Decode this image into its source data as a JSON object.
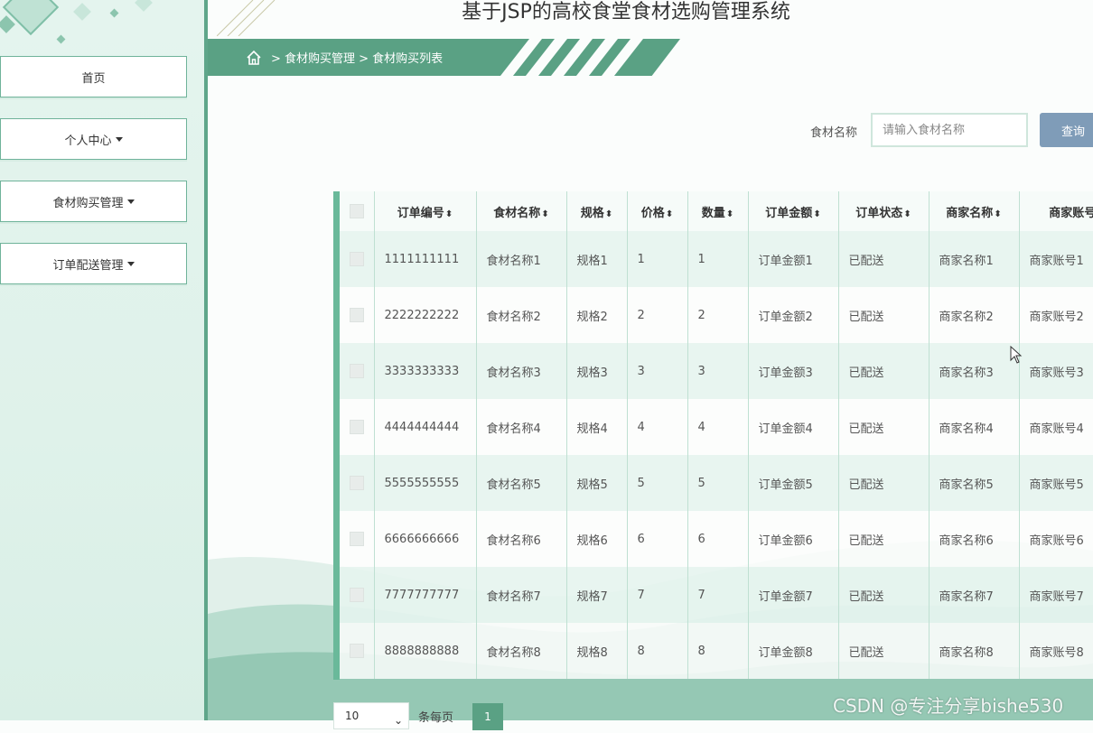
{
  "app_title": "基于JSP的高校食堂食材选购管理系统",
  "sidebar": {
    "items": [
      {
        "label": "首页",
        "has_caret": false
      },
      {
        "label": "个人中心",
        "has_caret": true
      },
      {
        "label": "食材购买管理",
        "has_caret": true
      },
      {
        "label": "订单配送管理",
        "has_caret": true
      }
    ]
  },
  "breadcrumb": {
    "home_icon": "home-icon",
    "text": "> 食材购买管理 > 食材购买列表"
  },
  "search": {
    "label": "食材名称",
    "placeholder": "请输入食材名称",
    "button_label": "查询"
  },
  "table": {
    "headers": [
      "订单编号",
      "食材名称",
      "规格",
      "价格",
      "数量",
      "订单金额",
      "订单状态",
      "商家名称",
      "商家账号"
    ],
    "sort_icon": "sort-icon",
    "rows": [
      [
        "1111111111",
        "食材名称1",
        "规格1",
        "1",
        "1",
        "订单金额1",
        "已配送",
        "商家名称1",
        "商家账号1"
      ],
      [
        "2222222222",
        "食材名称2",
        "规格2",
        "2",
        "2",
        "订单金额2",
        "已配送",
        "商家名称2",
        "商家账号2"
      ],
      [
        "3333333333",
        "食材名称3",
        "规格3",
        "3",
        "3",
        "订单金额3",
        "已配送",
        "商家名称3",
        "商家账号3"
      ],
      [
        "4444444444",
        "食材名称4",
        "规格4",
        "4",
        "4",
        "订单金额4",
        "已配送",
        "商家名称4",
        "商家账号4"
      ],
      [
        "5555555555",
        "食材名称5",
        "规格5",
        "5",
        "5",
        "订单金额5",
        "已配送",
        "商家名称5",
        "商家账号5"
      ],
      [
        "6666666666",
        "食材名称6",
        "规格6",
        "6",
        "6",
        "订单金额6",
        "已配送",
        "商家名称6",
        "商家账号6"
      ],
      [
        "7777777777",
        "食材名称7",
        "规格7",
        "7",
        "7",
        "订单金额7",
        "已配送",
        "商家名称7",
        "商家账号7"
      ],
      [
        "8888888888",
        "食材名称8",
        "规格8",
        "8",
        "8",
        "订单金额8",
        "已配送",
        "商家名称8",
        "商家账号8"
      ]
    ]
  },
  "pagination": {
    "page_size": "10",
    "per_page_label": "条每页",
    "current_page": "1"
  },
  "watermark": "CSDN @专注分享bishe530",
  "colors": {
    "accent": "#5aa184",
    "sidebar_bg": "#e4f4ee",
    "search_button": "#7f9cb8"
  }
}
